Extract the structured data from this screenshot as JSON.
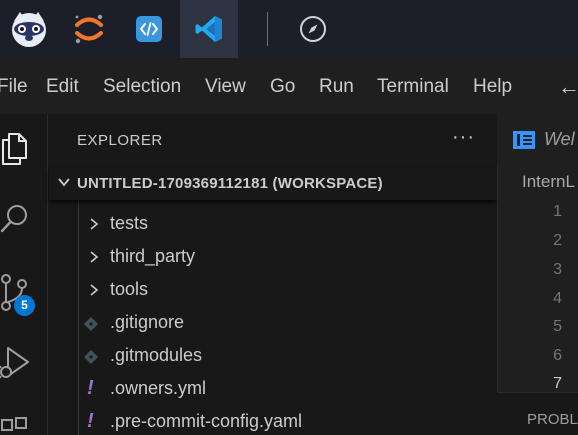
{
  "taskbar": {
    "apps": [
      {
        "name": "raccoon-app"
      },
      {
        "name": "jupyter-app"
      },
      {
        "name": "code-app"
      },
      {
        "name": "vscode-app",
        "active": true
      },
      {
        "name": "compass-app"
      }
    ]
  },
  "menubar": {
    "items": [
      "File",
      "Edit",
      "Selection",
      "View",
      "Go",
      "Run",
      "Terminal",
      "Help"
    ]
  },
  "activitybar": {
    "scm_badge": "5"
  },
  "explorer": {
    "title": "EXPLORER",
    "more_label": "···",
    "workspace_title": "UNTITLED-1709369112181 (WORKSPACE)",
    "items": [
      {
        "label": "tests",
        "kind": "folder"
      },
      {
        "label": "third_party",
        "kind": "folder"
      },
      {
        "label": "tools",
        "kind": "folder"
      },
      {
        "label": ".gitignore",
        "kind": "git"
      },
      {
        "label": ".gitmodules",
        "kind": "git"
      },
      {
        "label": ".owners.yml",
        "kind": "yaml"
      },
      {
        "label": ".pre-commit-config.yaml",
        "kind": "yaml"
      }
    ]
  },
  "editor": {
    "tab_label": "Wel",
    "breadcrumb": "InternL",
    "line_numbers": [
      "1",
      "2",
      "3",
      "4",
      "5",
      "6",
      "7"
    ],
    "panel_label": "PROBL"
  },
  "colors": {
    "accent": "#0078d4",
    "vscode_blue": "#23a9f2",
    "jupyter_orange": "#f37626",
    "yaml_purple": "#a074c4"
  }
}
